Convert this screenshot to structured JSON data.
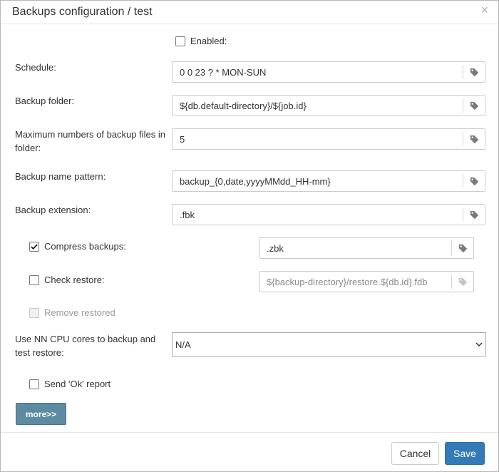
{
  "dialog": {
    "title": "Backups configuration / test",
    "close_label": "×"
  },
  "form": {
    "enabled_label": "Enabled:",
    "schedule_label": "Schedule:",
    "schedule_value": "0 0 23 ? * MON-SUN",
    "backup_folder_label": "Backup folder:",
    "backup_folder_value": "${db.default-directory}/${job.id}",
    "max_files_label": "Maximum numbers of backup files in folder:",
    "max_files_value": "5",
    "name_pattern_label": "Backup name pattern:",
    "name_pattern_value": "backup_{0,date,yyyyMMdd_HH-mm}",
    "extension_label": "Backup extension:",
    "extension_value": ".fbk",
    "compress_label": "Compress backups:",
    "compress_value": ".zbk",
    "check_restore_label": "Check restore:",
    "check_restore_value": "${backup-directory}/restore.${db.id}.fdb",
    "remove_restored_label": "Remove restored",
    "cpu_cores_label": "Use NN CPU cores to backup and test restore:",
    "cpu_cores_value": "N/A",
    "send_ok_label": "Send 'Ok' report",
    "more_label": "more>>"
  },
  "footer": {
    "cancel_label": "Cancel",
    "save_label": "Save"
  },
  "icons": {
    "tag": "tag-icon",
    "check": "check-icon",
    "chevron": "chevron-down-icon"
  },
  "colors": {
    "primary": "#337ab7",
    "more_button": "#5d8ba1"
  }
}
